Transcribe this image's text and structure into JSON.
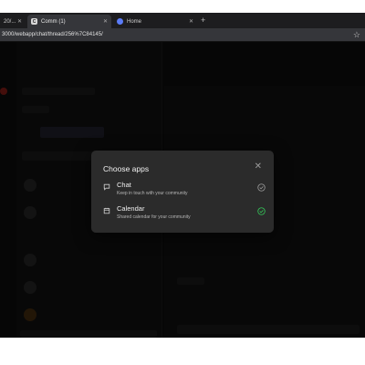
{
  "browser": {
    "tabs": [
      {
        "label": "20/...",
        "active": false
      },
      {
        "label": "Comm (1)",
        "active": true
      },
      {
        "label": "Home",
        "active": false
      }
    ],
    "url": "3000/webapp/chat/thread/256%7C84145/"
  },
  "modal": {
    "title": "Choose apps",
    "apps": [
      {
        "name": "Chat",
        "description": "Keep in touch with your community",
        "selected": false
      },
      {
        "name": "Calendar",
        "description": "Shared calendar for your community",
        "selected": true
      }
    ]
  },
  "colors": {
    "check_selected": "#34c759",
    "check_unselected": "#9a9a9a"
  }
}
